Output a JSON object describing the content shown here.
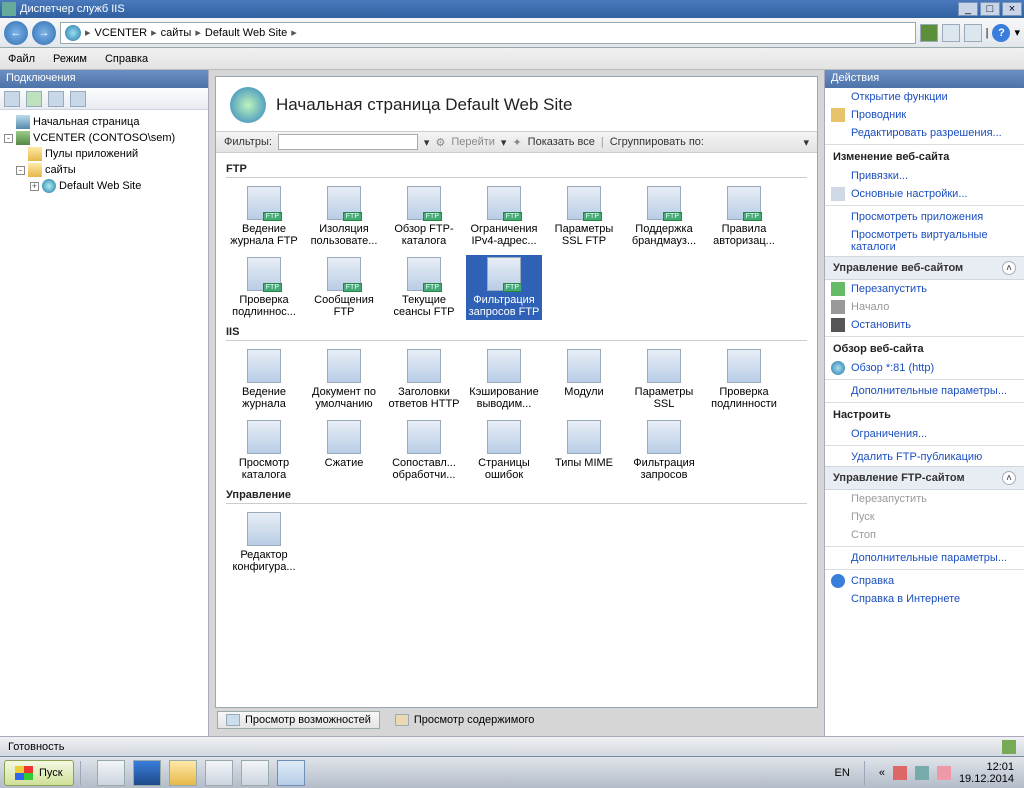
{
  "window": {
    "title": "Диспетчер служб IIS",
    "minimize": "_",
    "maximize": "□",
    "close": "×"
  },
  "breadcrumb": [
    "VCENTER",
    "сайты",
    "Default Web Site"
  ],
  "menu": [
    "Файл",
    "Режим",
    "Справка"
  ],
  "connectionsPanel": {
    "title": "Подключения"
  },
  "tree": {
    "start": "Начальная страница",
    "server": "VCENTER (CONTOSO\\sem)",
    "pools": "Пулы приложений",
    "sites": "сайты",
    "defaultSite": "Default Web Site"
  },
  "page": {
    "title": "Начальная страница Default Web Site"
  },
  "filterBar": {
    "filterLabel": "Фильтры:",
    "go": "Перейти",
    "showAll": "Показать все",
    "groupBy": "Сгруппировать по:"
  },
  "groups": {
    "ftp": {
      "title": "FTP",
      "items": [
        "Ведение журнала FTP",
        "Изоляция пользовате...",
        "Обзор FTP-каталога",
        "Ограничения IPv4-адрес...",
        "Параметры SSL FTP",
        "Поддержка брандмауз...",
        "Правила авторизац...",
        "Проверка подлиннос...",
        "Сообщения FTP",
        "Текущие сеансы FTP",
        "Фильтрация запросов FTP"
      ],
      "selectedIndex": 10
    },
    "iis": {
      "title": "IIS",
      "items": [
        "Ведение журнала",
        "Документ по умолчанию",
        "Заголовки ответов HTTP",
        "Кэширование выводим...",
        "Модули",
        "Параметры SSL",
        "Проверка подлинности",
        "Просмотр каталога",
        "Сжатие",
        "Сопоставл... обработчи...",
        "Страницы ошибок",
        "Типы MIME",
        "Фильтрация запросов"
      ]
    },
    "management": {
      "title": "Управление",
      "items": [
        "Редактор конфигура..."
      ]
    }
  },
  "viewTabs": {
    "features": "Просмотр возможностей",
    "content": "Просмотр содержимого"
  },
  "actions": {
    "title": "Действия",
    "links1": [
      "Открытие функции",
      "Проводник",
      "Редактировать разрешения..."
    ],
    "editSite": "Изменение веб-сайта",
    "links2": [
      "Привязки...",
      "Основные настройки...",
      "Просмотреть приложения",
      "Просмотреть виртуальные каталоги"
    ],
    "manageSite": "Управление веб-сайтом",
    "links3": [
      "Перезапустить",
      "Начало",
      "Остановить"
    ],
    "browseSite": "Обзор веб-сайта",
    "browseLink": "Обзор *:81 (http)",
    "advanced": "Дополнительные параметры...",
    "configure": "Настроить",
    "limits": "Ограничения...",
    "removeFtp": "Удалить FTP-публикацию",
    "manageFtp": "Управление FTP-сайтом",
    "links4": [
      "Перезапустить",
      "Пуск",
      "Стоп"
    ],
    "advanced2": "Дополнительные параметры...",
    "help": "Справка",
    "helpOnline": "Справка в Интернете"
  },
  "status": {
    "text": "Готовность"
  },
  "taskbar": {
    "start": "Пуск",
    "lang": "EN",
    "time": "12:01",
    "date": "19.12.2014"
  }
}
